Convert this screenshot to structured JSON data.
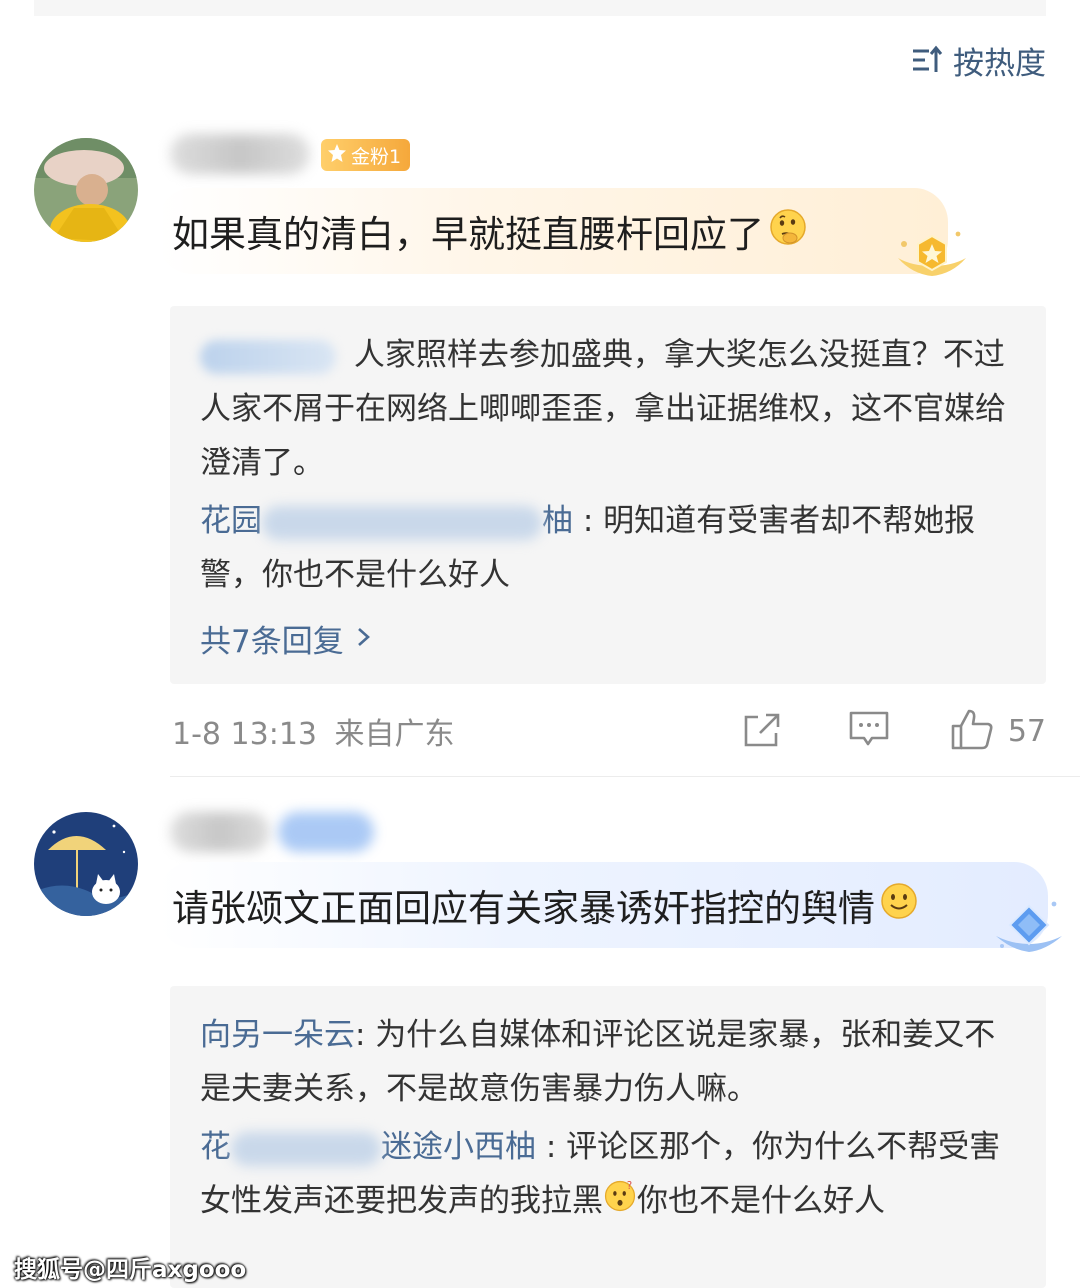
{
  "sort": {
    "label": "按热度",
    "icon": "sort-icon"
  },
  "comments": [
    {
      "badge": "金粉1",
      "text": "如果真的清白，早就挺直腰杆回应了",
      "emoji": "thinking-emoji",
      "replies": [
        {
          "name": "",
          "text": "人家照样去参加盛典，拿大奖怎么没挺直？不过人家不屑于在网络上唧唧歪歪，拿出证据维权，这不官媒给澄清了。"
        },
        {
          "name_start": "花园",
          "name_end": "柚",
          "text": ": 明知道有受害者却不帮她报警，你也不是什么好人"
        }
      ],
      "more": "共7条回复",
      "time": "1-8 13:13",
      "location": "来自广东",
      "likes": "57"
    },
    {
      "text": "请张颂文正面回应有关家暴诱奸指控的舆情",
      "emoji": "smile-emoji",
      "replies": [
        {
          "name": "向另一朵云",
          "text": ": 为什么自媒体和评论区说是家暴，张和姜又不是夫妻关系，不是故意伤害暴力伤人嘛。"
        },
        {
          "name_start": "花",
          "name_end": "迷途小西柚",
          "text": ": 评论区那个，你为什么不帮受害女性发声还要把发声的我拉黑",
          "text_after": "你也不是什么好人"
        }
      ]
    }
  ],
  "watermark": "搜狐号@四斤axgooo"
}
